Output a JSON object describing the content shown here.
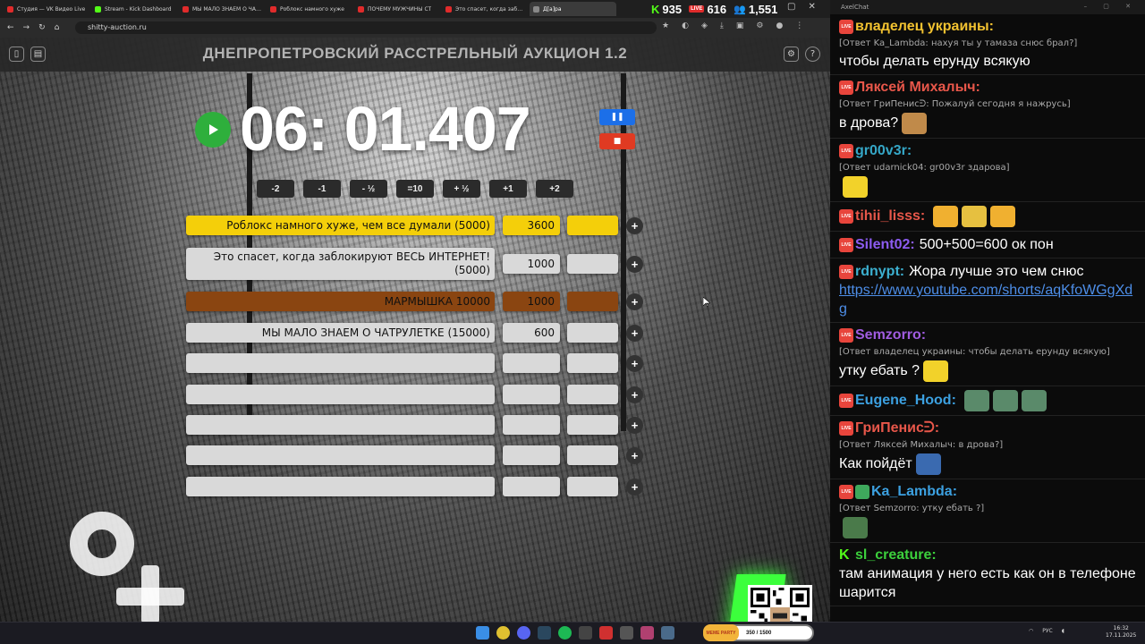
{
  "browser": {
    "tabs": [
      {
        "label": "Студия — VK Видео Live",
        "color": "#e02b2b"
      },
      {
        "label": "Stream - Kick Dashboard",
        "color": "#53fc18"
      },
      {
        "label": "МЫ МАЛО ЗНАЕМ О ЧАТРУЛЕТКЕ",
        "color": "#e02b2b"
      },
      {
        "label": "Роблокс намного хуже",
        "color": "#e02b2b"
      },
      {
        "label": "ПОЧЕМУ МУЖЧИНЫ СТ",
        "color": "#e02b2b"
      },
      {
        "label": "Это спасет, когда заблок",
        "color": "#e02b2b"
      },
      {
        "label": "Д[а]ра",
        "color": "#888888",
        "active": true
      }
    ],
    "url": "shitty-auction.ru",
    "stats": {
      "kick_viewers": "935",
      "vk_viewers": "616",
      "viewers_total": "1,551"
    }
  },
  "auction": {
    "title": "ДНЕПРОПЕТРОВСКИЙ РАССТРЕЛЬНЫЙ АУКЦИОН 1.2",
    "timer": "06: 01.407",
    "adjust_buttons": [
      "-2",
      "-1",
      "- ½",
      "=10",
      "+ ½",
      "+1",
      "+2"
    ],
    "lots": [
      {
        "name": "Роблокс намного хуже, чем все думали (5000)",
        "amount": "3600",
        "style": "gold"
      },
      {
        "name": "Это спасет, когда заблокируют ВЕСЬ ИНТЕРНЕТ! (5000)",
        "amount": "1000",
        "style": "plain"
      },
      {
        "name": "МАРМЫШКА 10000",
        "amount": "1000",
        "style": "brown"
      },
      {
        "name": "МЫ МАЛО ЗНАЕМ О ЧАТРУЛЕТКЕ (15000)",
        "amount": "600",
        "style": "plain"
      },
      {
        "name": "",
        "amount": "",
        "style": "plain"
      },
      {
        "name": "",
        "amount": "",
        "style": "plain"
      },
      {
        "name": "",
        "amount": "",
        "style": "plain"
      },
      {
        "name": "",
        "amount": "",
        "style": "plain"
      },
      {
        "name": "",
        "amount": "",
        "style": "plain"
      }
    ]
  },
  "chat": {
    "window_title": "AxelChat",
    "messages": [
      {
        "platform": "vk",
        "nick": "владелец украины:",
        "color": "#f2c230",
        "reply": "[Ответ Ka_Lambda: нахуя ты у тамаза снюс брал?]",
        "text": "чтобы делать ерунду всякую"
      },
      {
        "platform": "vk",
        "nick": "Ляксей Михалыч:",
        "color": "#e8574a",
        "reply": "[Ответ ГриПенисᕭ: Пожалуй сегодня я нажрусь]",
        "text": "в дрова?",
        "emotes": [
          "#c08a4a"
        ]
      },
      {
        "platform": "vk",
        "nick": "gr00v3r:",
        "color": "#35a7c7",
        "reply": "[Ответ udarnick04: gr00v3r здарова]",
        "text": "",
        "emotes": [
          "#f2d22a"
        ]
      },
      {
        "platform": "vk",
        "nick": "tihii_lisss:",
        "color": "#e8574a",
        "reply": "",
        "text": "",
        "emotes": [
          "#f0b030",
          "#e6c040",
          "#f0b030"
        ]
      },
      {
        "platform": "vk",
        "nick": "Silent02:",
        "color": "#8c5cf0",
        "reply": "",
        "text": "500+500=600 ок пон"
      },
      {
        "platform": "vk",
        "nick": "rdnypt:",
        "color": "#3cb0d0",
        "reply": "",
        "text": "Жора лучше это чем снюс",
        "link": "https://www.youtube.com/shorts/aqKfoWGgXdg"
      },
      {
        "platform": "vk",
        "nick": "Semzorro:",
        "color": "#a05ce0",
        "reply": "[Ответ владелец украины: чтобы делать ерунду всякую]",
        "text": "утку ебать ?",
        "emotes": [
          "#f2d22a"
        ]
      },
      {
        "platform": "vk",
        "nick": "Eugene_Hood:",
        "color": "#3ca0e0",
        "reply": "",
        "text": "",
        "emotes": [
          "#5a8a6a",
          "#5a8a6a",
          "#5a8a6a"
        ]
      },
      {
        "platform": "vk",
        "nick": "ГриПенисᕭ:",
        "color": "#e8574a",
        "reply": "[Ответ Ляксей Михалыч: в дрова?]",
        "text": "Как пойдёт",
        "emotes": [
          "#3a6ab0"
        ]
      },
      {
        "platform": "vk",
        "nick": "Ka_Lambda:",
        "color": "#3ca0e0",
        "reply": "[Ответ Semzorro: утку ебать ?]",
        "text": "",
        "emotes": [
          "#4a7a4a"
        ],
        "shield": true
      },
      {
        "platform": "kick",
        "nick": "sl_creature:",
        "color": "#3cd03c",
        "reply": "",
        "text": "там анимация у него есть как он в телефоне шарится"
      }
    ]
  },
  "taskbar": {
    "meme_label": "MEME PARTY",
    "meme_value": "350 / 1500",
    "tray_lang": "РУС",
    "time": "16:32",
    "date": "17.11.2025"
  }
}
